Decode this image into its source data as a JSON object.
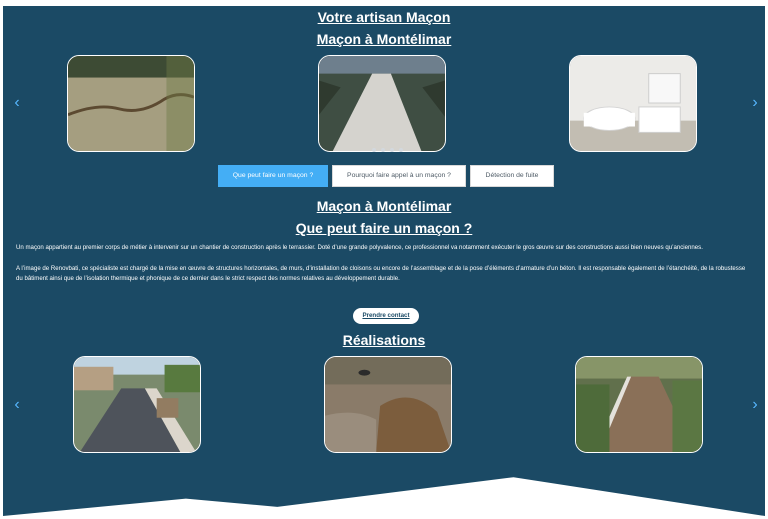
{
  "hero": {
    "title_1": "Votre artisan Maçon",
    "title_2": "Maçon à Montélimar"
  },
  "carousel_top": {
    "prev_label": "‹",
    "next_label": "›",
    "images": [
      "concrete-slab",
      "concrete-path",
      "bathroom"
    ],
    "indicator_count": 4
  },
  "tabs": [
    {
      "label": "Que peut faire un maçon ?"
    },
    {
      "label": "Pourquoi faire appel à un maçon ?"
    },
    {
      "label": "Détection de fuite"
    }
  ],
  "content": {
    "title_1": "Maçon à Montélimar",
    "title_2": "Que peut faire un maçon ?",
    "paragraph_1": "Un maçon appartient au premier corps de métier à intervenir sur un chantier de construction après le terrassier. Doté d’une grande polyvalence, ce professionnel va notamment exécuter le gros œuvre sur des constructions aussi bien neuves qu’anciennes.",
    "paragraph_2": "A l’image de Renovbati, ce spécialiste est chargé de la mise en œuvre de structures horizontales, de murs, d’installation de cloisons ou encore de l’assemblage et de la pose d’éléments d’armature d’un béton. Il est responsable également de l’étanchéité, de la robustesse du bâtiment ainsi que de l’isolation thermique et phonique de ce dernier dans le strict respect des normes relatives au développement durable."
  },
  "cta": {
    "label": "Prendre contact"
  },
  "realisations": {
    "title": "Réalisations",
    "prev_label": "‹",
    "next_label": "›",
    "images": [
      "asphalt-driveway",
      "excavation",
      "garden-path"
    ]
  },
  "colors": {
    "panel": "#1b4a65",
    "accent": "#44aef5",
    "arrow": "#57b7ff"
  }
}
